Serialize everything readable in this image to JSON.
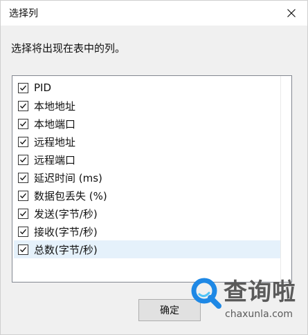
{
  "window": {
    "title": "选择列",
    "close_icon": "close-icon"
  },
  "instruction": "选择将出现在表中的列。",
  "columns": [
    {
      "label": "PID",
      "checked": true
    },
    {
      "label": "本地地址",
      "checked": true
    },
    {
      "label": "本地端口",
      "checked": true
    },
    {
      "label": "远程地址",
      "checked": true
    },
    {
      "label": "远程端口",
      "checked": true
    },
    {
      "label": "延迟时间 (ms)",
      "checked": true
    },
    {
      "label": "数据包丢失 (%)",
      "checked": true
    },
    {
      "label": "发送(字节/秒)",
      "checked": true
    },
    {
      "label": "接收(字节/秒)",
      "checked": true
    },
    {
      "label": "总数(字节/秒)",
      "checked": true,
      "selected": true
    }
  ],
  "buttons": {
    "ok_label": "确定"
  },
  "watermark": {
    "brand": "查询啦",
    "url": "chaxunla.com",
    "logo_icon": "search-magnifier-logo"
  },
  "colors": {
    "selection": "#e5f1fb",
    "watermark_blue": "#1e88e5"
  }
}
